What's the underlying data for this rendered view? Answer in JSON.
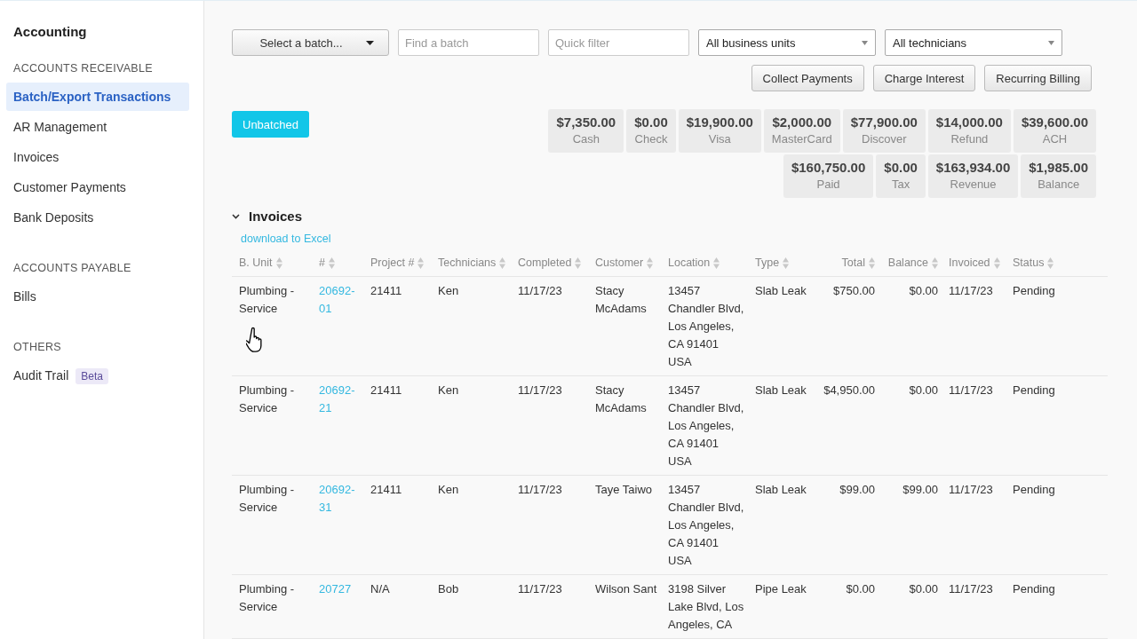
{
  "sidebar": {
    "title": "Accounting",
    "sections": [
      {
        "heading": "ACCOUNTS RECEIVABLE",
        "items": [
          {
            "label": "Batch/Export Transactions",
            "selected": true
          },
          {
            "label": "AR Management",
            "selected": false
          },
          {
            "label": "Invoices",
            "selected": false
          },
          {
            "label": "Customer Payments",
            "selected": false
          },
          {
            "label": "Bank Deposits",
            "selected": false
          }
        ]
      },
      {
        "heading": "ACCOUNTS PAYABLE",
        "items": [
          {
            "label": "Bills",
            "selected": false
          }
        ]
      },
      {
        "heading": "OTHERS",
        "items": [
          {
            "label": "Audit Trail",
            "selected": false,
            "badge": "Beta"
          }
        ]
      }
    ]
  },
  "toolbar": {
    "batch_button": "Select a batch...",
    "find_field": {
      "placeholder": "Find a batch"
    },
    "filter_field": {
      "placeholder": "Quick filter"
    },
    "business_units": "All business units",
    "technicians": "All technicians",
    "actions": [
      "Collect Payments",
      "Charge Interest",
      "Recurring Billing"
    ]
  },
  "unbatched_button": "Unbatched",
  "totals": [
    {
      "items": [
        {
          "amount": "$7,350.00",
          "label": "Cash"
        },
        {
          "amount": "$0.00",
          "label": "Check"
        },
        {
          "amount": "$19,900.00",
          "label": "Visa"
        },
        {
          "amount": "$2,000.00",
          "label": "MasterCard"
        },
        {
          "amount": "$77,900.00",
          "label": "Discover"
        },
        {
          "amount": "$14,000.00",
          "label": "Refund"
        },
        {
          "amount": "$39,600.00",
          "label": "ACH"
        }
      ]
    },
    {
      "items": [
        {
          "amount": "$160,750.00",
          "label": "Paid"
        },
        {
          "amount": "$0.00",
          "label": "Tax"
        },
        {
          "amount": "$163,934.00",
          "label": "Revenue"
        },
        {
          "amount": "$1,985.00",
          "label": "Balance"
        }
      ]
    }
  ],
  "invoices": {
    "title": "Invoices",
    "expanded": true,
    "download_link": "download to Excel",
    "columns": [
      "B. Unit",
      "#",
      "Project #",
      "Technicians",
      "Completed",
      "Customer",
      "Location",
      "Type",
      "Total",
      "Balance",
      "Invoiced",
      "Status"
    ],
    "rows": [
      {
        "cells": [
          "Plumbing - Service",
          "20692-01",
          "21411",
          "Ken",
          "11/17/23",
          "Stacy McAdams",
          "13457 Chandler Blvd, Los Angeles, CA 91401 USA",
          "Slab Leak",
          "$750.00",
          "$0.00",
          "11/17/23",
          "Pending"
        ],
        "cursor": true
      },
      {
        "cells": [
          "Plumbing - Service",
          "20692-21",
          "21411",
          "Ken",
          "11/17/23",
          "Stacy McAdams",
          "13457 Chandler Blvd, Los Angeles, CA 91401 USA",
          "Slab Leak",
          "$4,950.00",
          "$0.00",
          "11/17/23",
          "Pending"
        ],
        "cursor": false
      },
      {
        "cells": [
          "Plumbing - Service",
          "20692-31",
          "21411",
          "Ken",
          "11/17/23",
          "Taye Taiwo",
          "13457 Chandler Blvd, Los Angeles, CA 91401 USA",
          "Slab Leak",
          "$99.00",
          "$99.00",
          "11/17/23",
          "Pending"
        ],
        "cursor": false
      },
      {
        "cells": [
          "Plumbing - Service",
          "20727",
          "N/A",
          "Bob",
          "11/17/23",
          "Wilson Sant",
          "3198 Silver Lake Blvd, Los Angeles, CA",
          "Pipe Leak",
          "$0.00",
          "$0.00",
          "11/17/23",
          "Pending"
        ],
        "cursor": false
      }
    ]
  }
}
